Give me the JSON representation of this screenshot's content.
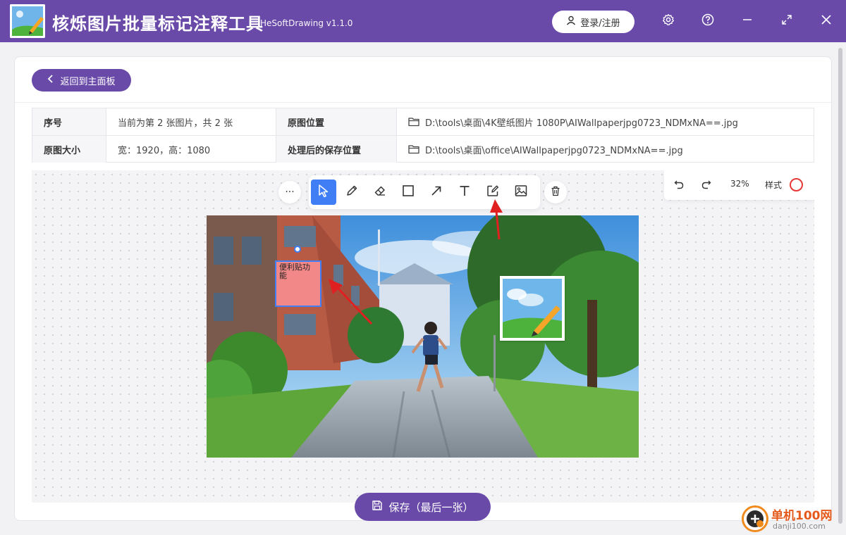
{
  "app": {
    "title": "核烁图片批量标记注释工具",
    "version": "HeSoftDrawing v1.1.0",
    "login_label": "登录/注册"
  },
  "nav": {
    "back_label": "返回到主面板"
  },
  "info": {
    "seq_label": "序号",
    "seq_value": "当前为第 2 张图片，共 2 张",
    "orig_loc_label": "原图位置",
    "orig_loc_value": "D:\\tools\\桌面\\4K壁纸图片 1080P\\AIWallpaperjpg0723_NDMxNA==.jpg",
    "size_label": "原图大小",
    "size_value": "宽：1920，高：1080",
    "save_loc_label": "处理后的保存位置",
    "save_loc_value": "D:\\tools\\桌面\\office\\AIWallpaperjpg0723_NDMxNA==.jpg"
  },
  "toolbar": {
    "more_label": "···",
    "tools": [
      "select-tool",
      "pencil-tool",
      "eraser-tool",
      "rectangle-tool",
      "arrow-tool",
      "text-tool",
      "sticky-note-tool",
      "image-tool"
    ],
    "active_tool": "select-tool"
  },
  "right_panel": {
    "zoom": "32%",
    "style_label": "样式",
    "style_color": "#e53935"
  },
  "canvas": {
    "sticky_text": "便利贴功能",
    "sticky_color": "#f38888",
    "selection_color": "#3f7ef5",
    "arrow_color": "#e02020"
  },
  "footer": {
    "save_label": "保存（最后一张）"
  },
  "watermark": {
    "brand": "单机100网",
    "url": "danji100.com"
  },
  "colors": {
    "brand": "#6a4aa8",
    "accent": "#3f7ef5"
  }
}
